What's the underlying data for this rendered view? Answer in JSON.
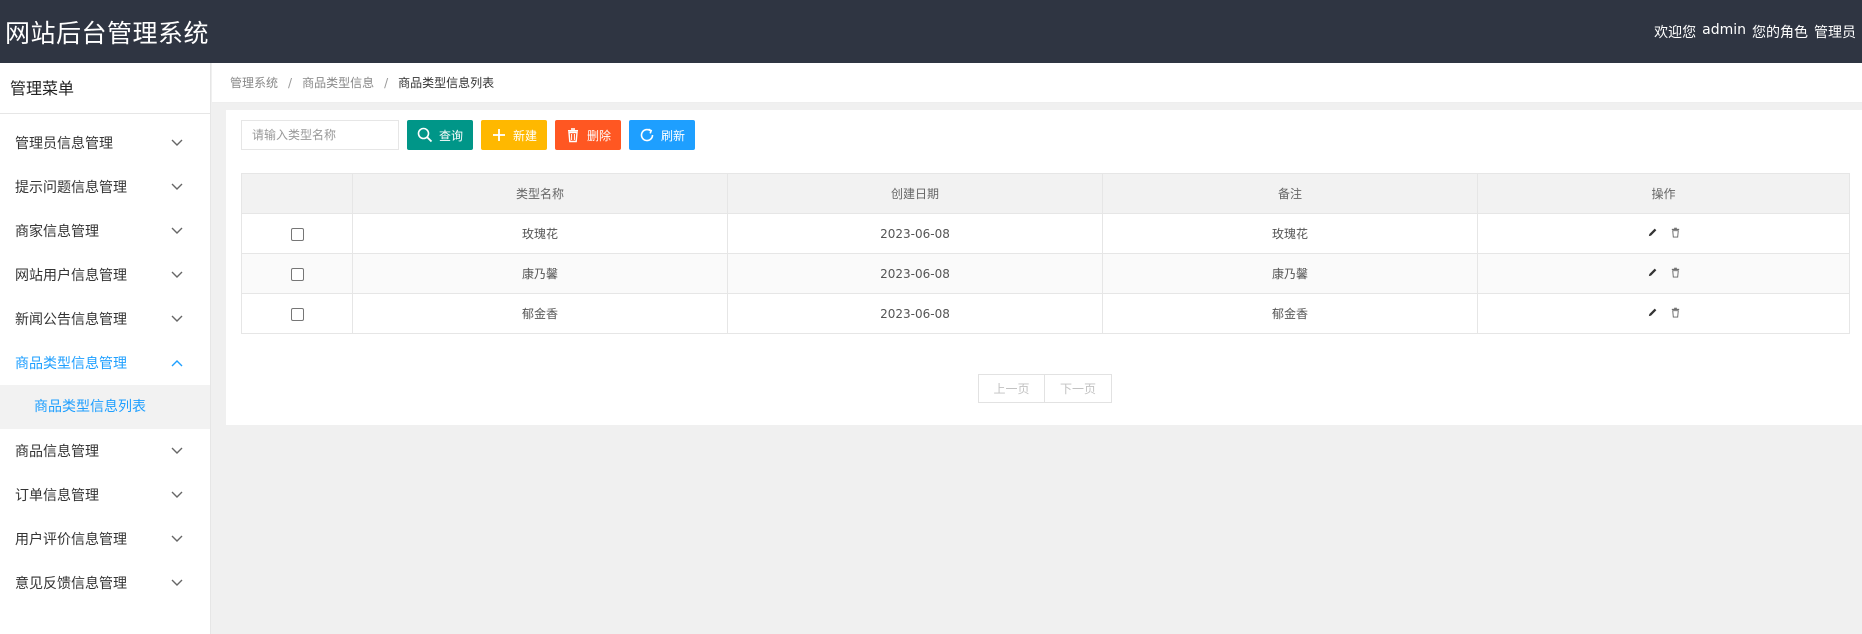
{
  "header": {
    "title": "网站后台管理系统",
    "welcome": "欢迎您",
    "username": "admin",
    "role_label": "您的角色",
    "role": "管理员"
  },
  "sidebar": {
    "title": "管理菜单",
    "items": [
      {
        "label": "管理员信息管理"
      },
      {
        "label": "提示问题信息管理"
      },
      {
        "label": "商家信息管理"
      },
      {
        "label": "网站用户信息管理"
      },
      {
        "label": "新闻公告信息管理"
      },
      {
        "label": "商品类型信息管理"
      },
      {
        "label": "商品信息管理"
      },
      {
        "label": "订单信息管理"
      },
      {
        "label": "用户评价信息管理"
      },
      {
        "label": "意见反馈信息管理"
      }
    ],
    "submenu": {
      "label": "商品类型信息列表"
    }
  },
  "breadcrumb": {
    "items": [
      "管理系统",
      "商品类型信息",
      "商品类型信息列表"
    ],
    "separator": "/"
  },
  "toolbar": {
    "search_placeholder": "请输入类型名称",
    "query_label": "查询",
    "add_label": "新建",
    "delete_label": "删除",
    "refresh_label": "刷新"
  },
  "table": {
    "headers": [
      "",
      "类型名称",
      "创建日期",
      "备注",
      "操作"
    ],
    "rows": [
      {
        "name": "玫瑰花",
        "date": "2023-06-08",
        "note": "玫瑰花"
      },
      {
        "name": "康乃馨",
        "date": "2023-06-08",
        "note": "康乃馨"
      },
      {
        "name": "郁金香",
        "date": "2023-06-08",
        "note": "郁金香"
      }
    ]
  },
  "pager": {
    "prev_label": "上一页",
    "next_label": "下一页"
  },
  "colors": {
    "header_bg": "#2f3542",
    "accent": "#1e9fff",
    "teal": "#009688",
    "orange": "#ffb800",
    "red": "#ff5722"
  }
}
